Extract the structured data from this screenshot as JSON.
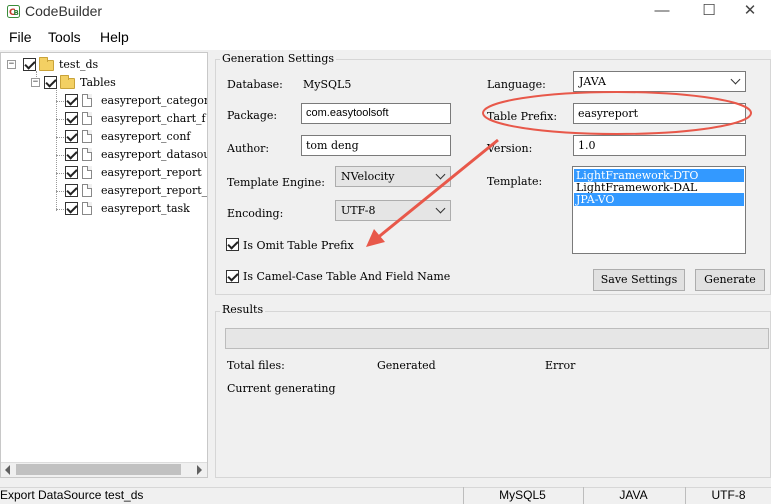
{
  "window": {
    "title": "CodeBuilder",
    "minimize_glyph": "—",
    "maximize_glyph": "☐",
    "close_glyph": "✕",
    "icon": "app-logo-icon"
  },
  "menu": {
    "items": [
      "File",
      "Tools",
      "Help"
    ]
  },
  "tree": {
    "root": {
      "label": "test_ds",
      "checked": true,
      "icon": "folder-icon"
    },
    "tables_node": {
      "label": "Tables",
      "checked": true,
      "icon": "folder-icon"
    },
    "items": [
      {
        "label": "easyreport_category",
        "checked": true
      },
      {
        "label": "easyreport_chart_f",
        "checked": true
      },
      {
        "label": "easyreport_conf",
        "checked": true
      },
      {
        "label": "easyreport_datasource",
        "checked": true
      },
      {
        "label": "easyreport_report",
        "checked": true
      },
      {
        "label": "easyreport_report_h",
        "checked": true
      },
      {
        "label": "easyreport_task",
        "checked": true
      }
    ]
  },
  "settings": {
    "group_title": "Generation Settings",
    "database_label": "Database:",
    "database_value": "MySQL5",
    "language_label": "Language:",
    "language_value": "JAVA",
    "package_label": "Package:",
    "package_value": "com.easytoolsoft",
    "table_prefix_label": "Table Prefix:",
    "table_prefix_value": "easyreport",
    "author_label": "Author:",
    "author_value": "tom deng",
    "version_label": "Version:",
    "version_value": "1.0",
    "template_engine_label": "Template Engine:",
    "template_engine_value": "NVelocity",
    "template_label": "Template:",
    "templates": [
      {
        "label": "LightFramework-DTO",
        "selected": true
      },
      {
        "label": "LightFramework-DAL",
        "selected": false
      },
      {
        "label": "JPA-VO",
        "selected": true
      }
    ],
    "encoding_label": "Encoding:",
    "encoding_value": "UTF-8",
    "omit_prefix_label": "Is Omit Table Prefix",
    "omit_prefix_checked": true,
    "camel_case_label": "Is Camel-Case Table And Field Name",
    "camel_case_checked": true,
    "save_button": "Save Settings",
    "generate_button": "Generate"
  },
  "results": {
    "group_title": "Results",
    "progress": 0,
    "total_files_label": "Total files:",
    "generated_label": "Generated",
    "error_label": "Error",
    "current_generating_label": "Current generating"
  },
  "annotation": {
    "color": "#e8584a"
  },
  "statusbar": {
    "message": "Export DataSource test_ds",
    "database": "MySQL5",
    "language": "JAVA",
    "encoding": "UTF-8"
  }
}
